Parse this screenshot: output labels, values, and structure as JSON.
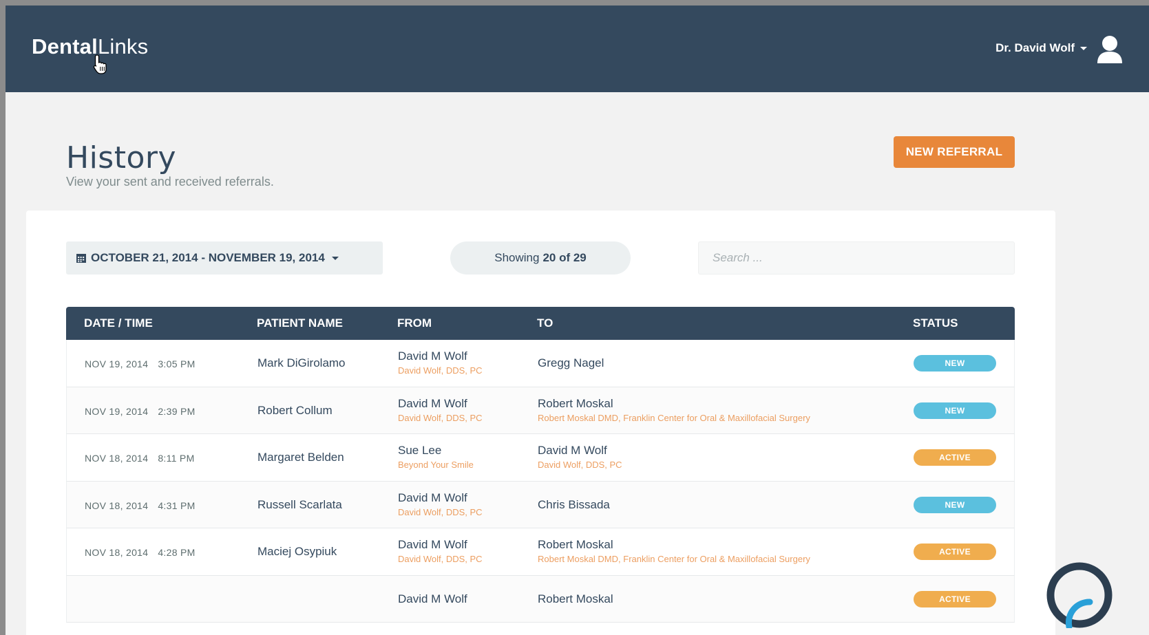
{
  "app": {
    "logo_bold": "Dental",
    "logo_light": "Links",
    "user_name": "Dr. David Wolf"
  },
  "page": {
    "title": "History",
    "subtitle": "View your sent and received referrals.",
    "new_referral_label": "NEW REFERRAL"
  },
  "filters": {
    "date_range": "OCTOBER 21, 2014 - NOVEMBER 19, 2014",
    "showing_prefix": "Showing",
    "showing_count": "20 of 29",
    "search_placeholder": "Search ..."
  },
  "table": {
    "headers": {
      "date": "DATE / TIME",
      "patient": "PATIENT NAME",
      "from": "FROM",
      "to": "TO",
      "status": "STATUS"
    },
    "rows": [
      {
        "date": "NOV 19, 2014",
        "time": "3:05 PM",
        "patient": "Mark DiGirolamo",
        "from_name": "David M Wolf",
        "from_org": "David Wolf, DDS, PC",
        "to_name": "Gregg Nagel",
        "to_org": "",
        "status": "NEW"
      },
      {
        "date": "NOV 19, 2014",
        "time": "2:39 PM",
        "patient": "Robert Collum",
        "from_name": "David M Wolf",
        "from_org": "David Wolf, DDS, PC",
        "to_name": "Robert Moskal",
        "to_org": "Robert Moskal DMD, Franklin Center for Oral & Maxillofacial Surgery",
        "status": "NEW"
      },
      {
        "date": "NOV 18, 2014",
        "time": "8:11 PM",
        "patient": "Margaret Belden",
        "from_name": "Sue Lee",
        "from_org": "Beyond Your Smile",
        "to_name": "David M Wolf",
        "to_org": "David Wolf, DDS, PC",
        "status": "ACTIVE"
      },
      {
        "date": "NOV 18, 2014",
        "time": "4:31 PM",
        "patient": "Russell Scarlata",
        "from_name": "David M Wolf",
        "from_org": "David Wolf, DDS, PC",
        "to_name": "Chris Bissada",
        "to_org": "",
        "status": "NEW"
      },
      {
        "date": "NOV 18, 2014",
        "time": "4:28 PM",
        "patient": "Maciej Osypiuk",
        "from_name": "David M Wolf",
        "from_org": "David Wolf, DDS, PC",
        "to_name": "Robert Moskal",
        "to_org": "Robert Moskal DMD, Franklin Center for Oral & Maxillofacial Surgery",
        "status": "ACTIVE"
      },
      {
        "date": "",
        "time": "",
        "patient": "",
        "from_name": "David M Wolf",
        "from_org": "",
        "to_name": "Robert Moskal",
        "to_org": "",
        "status": "ACTIVE"
      }
    ]
  },
  "colors": {
    "navbar": "#34495e",
    "accent": "#e8873a",
    "badge_new": "#5bc0de",
    "badge_active": "#f0ad4e"
  },
  "icons": [
    "user-icon",
    "calendar-icon",
    "caret-down-icon",
    "pointer-cursor-icon",
    "loading-spinner-icon"
  ]
}
